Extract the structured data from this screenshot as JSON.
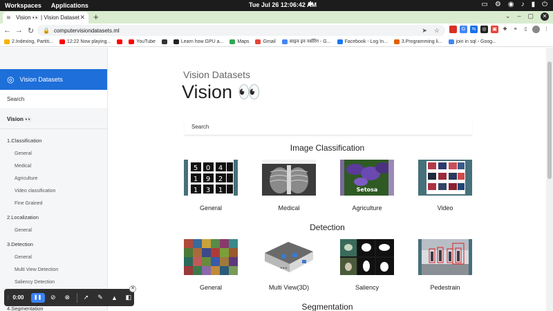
{
  "os": {
    "workspaces": "Workspaces",
    "applications": "Applications",
    "clock": "Tue Jul 26  12:06:42 AM"
  },
  "browser": {
    "tab_title": "Vision 👀 | Vision Datasets",
    "url": "computervisiondatasets.ml",
    "bookmarks": [
      {
        "label": "2.Indexing, Partiti...",
        "color": "#f4b400"
      },
      {
        "label": "12:22 Now playing...",
        "color": "#ff0000"
      },
      {
        "label": "",
        "color": "#ff0000"
      },
      {
        "label": "YouTube",
        "color": "#ff0000"
      },
      {
        "label": "",
        "color": "#333333"
      },
      {
        "label": "Learn how GPU a...",
        "color": "#222222"
      },
      {
        "label": "Maps",
        "color": "#34a853"
      },
      {
        "label": "Gmail",
        "color": "#ea4335"
      },
      {
        "label": "साइन इन नर्सरिंग - G...",
        "color": "#4285f4"
      },
      {
        "label": "Facebook - Log In...",
        "color": "#1877f2"
      },
      {
        "label": "3.Programming li...",
        "color": "#e06000"
      },
      {
        "label": "join in sql - Goog...",
        "color": "#4285f4"
      }
    ]
  },
  "sidebar": {
    "brand": "Vision Datasets",
    "search_placeholder": "Search",
    "home": "Vision 👀",
    "items": [
      {
        "label": "1.Classification",
        "type": "section"
      },
      {
        "label": "General",
        "type": "item"
      },
      {
        "label": "Medical",
        "type": "item"
      },
      {
        "label": "Agriculture",
        "type": "item"
      },
      {
        "label": "Video classification",
        "type": "item"
      },
      {
        "label": "Fine Grained",
        "type": "item"
      },
      {
        "label": "2.Localization",
        "type": "section"
      },
      {
        "label": "General",
        "type": "item"
      },
      {
        "label": "3.Detection",
        "type": "section"
      },
      {
        "label": "General",
        "type": "item"
      },
      {
        "label": "Multi View Detection",
        "type": "item"
      },
      {
        "label": "Saliency Detection",
        "type": "item"
      },
      {
        "label": "",
        "type": "item"
      },
      {
        "label": "4.Segmentation",
        "type": "section"
      }
    ]
  },
  "main": {
    "subtitle": "Vision Datasets",
    "title": "Vision 👀",
    "search_placeholder": "Search",
    "sections": [
      {
        "heading": "Image Classification",
        "cards": [
          "General",
          "Medical",
          "Agriculture",
          "Video"
        ]
      },
      {
        "heading": "Detection",
        "cards": [
          "General",
          "Multi View(3D)",
          "Saliency",
          "Pedestrain"
        ]
      },
      {
        "heading": "Segmentation",
        "cards": []
      }
    ],
    "agri_overlay": "Setosa"
  },
  "recorder": {
    "time": "0:00"
  }
}
